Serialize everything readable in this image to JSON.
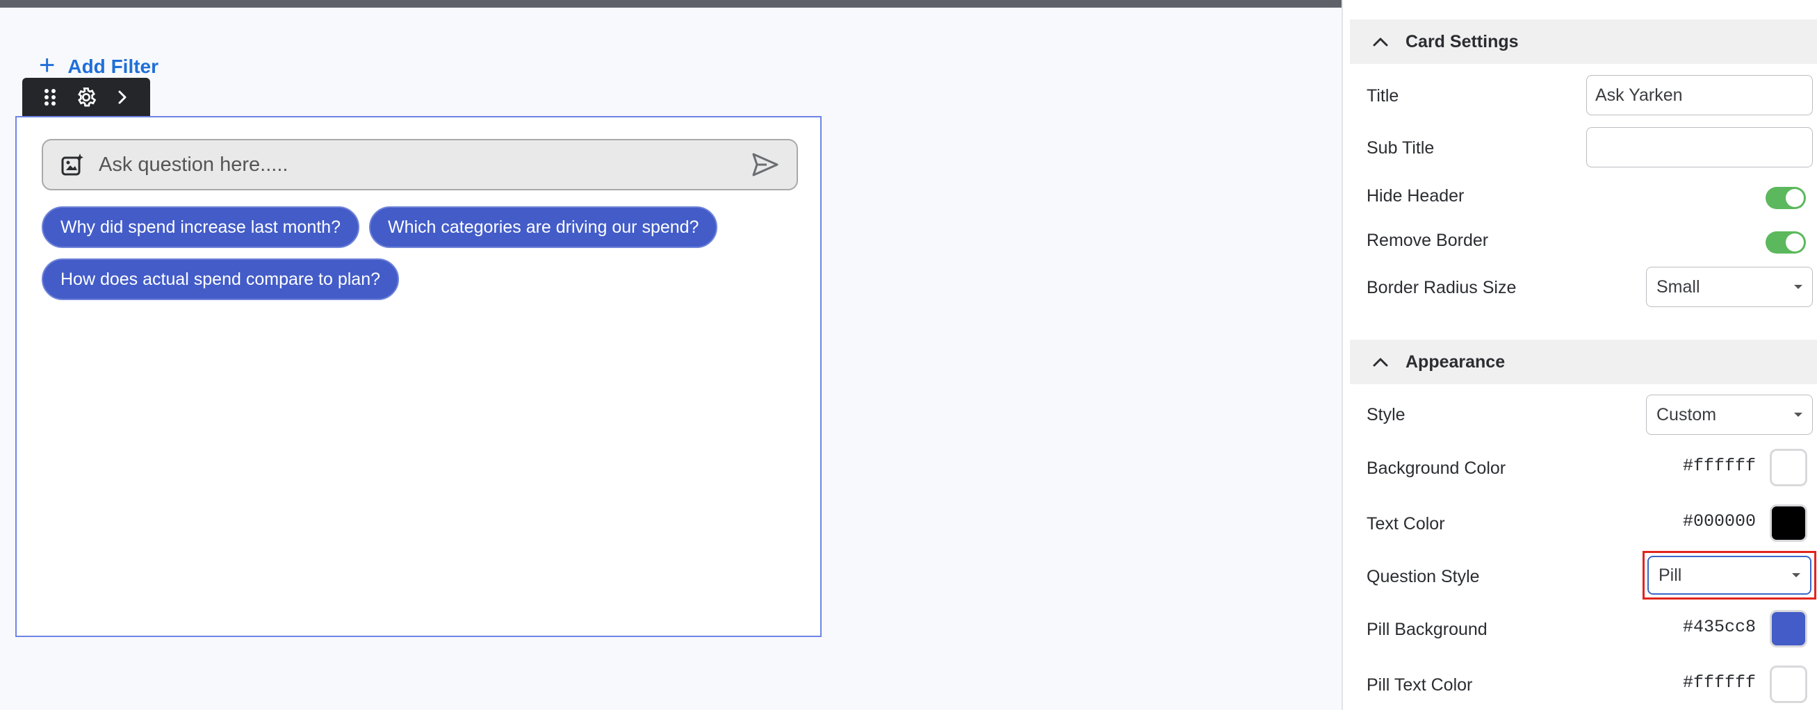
{
  "canvas": {
    "add_filter_label": "Add Filter",
    "ask_placeholder": "Ask question here.....",
    "questions": [
      "Why did spend increase last month?",
      "Which categories are driving our spend?",
      "How does actual spend compare to plan?"
    ]
  },
  "panel": {
    "card_settings": {
      "heading": "Card Settings",
      "title_label": "Title",
      "title_value": "Ask Yarken",
      "subtitle_label": "Sub Title",
      "subtitle_value": "",
      "hide_header_label": "Hide Header",
      "hide_header_on": true,
      "remove_border_label": "Remove Border",
      "remove_border_on": true,
      "border_radius_label": "Border Radius Size",
      "border_radius_value": "Small"
    },
    "appearance": {
      "heading": "Appearance",
      "style_label": "Style",
      "style_value": "Custom",
      "bg_color_label": "Background Color",
      "bg_color_value": "#ffffff",
      "text_color_label": "Text Color",
      "text_color_value": "#000000",
      "question_style_label": "Question Style",
      "question_style_value": "Pill",
      "pill_bg_label": "Pill Background",
      "pill_bg_value": "#435cc8",
      "pill_text_label": "Pill Text Color",
      "pill_text_value": "#ffffff"
    }
  },
  "colors": {
    "accent": "#435cc8",
    "link": "#1f6fd8",
    "toggle_on": "#5cb85c",
    "highlight": "#e1251b"
  }
}
